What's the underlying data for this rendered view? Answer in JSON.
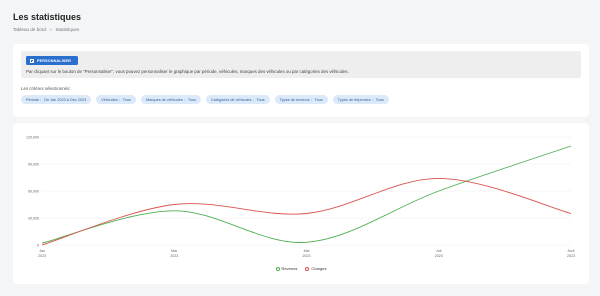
{
  "header": {
    "title": "Les statistiques",
    "breadcrumb": [
      "Tableau de bord",
      "Statistiques"
    ],
    "breadcrumb_sep": "›"
  },
  "filters": {
    "button_label": "PERSONNALISER",
    "info_text": "Par cliquant sur le bouton de \"Personnaliser\", vous pouvez personnaliser le graphique par période, véhicules, marques des véhicules ou par catégories des véhicules.",
    "criteria_label": "Les critères sélectionnés:",
    "chips": [
      {
        "key": "Période :",
        "value": "De Jan 2023 à Dec 2023"
      },
      {
        "key": "Véhicules :",
        "value": "Tous"
      },
      {
        "key": "Marques de véhicules :",
        "value": "Tous"
      },
      {
        "key": "Catégories de véhicules :",
        "value": "Tous"
      },
      {
        "key": "Types de revenus :",
        "value": "Tous"
      },
      {
        "key": "Types de dépenses :",
        "value": "Tous"
      }
    ]
  },
  "colors": {
    "revenus": "#4caf50",
    "charges": "#d9534f",
    "accent": "#2b6fce"
  },
  "chart_data": {
    "type": "line",
    "categories": [
      "Jan\n2023",
      "Mar\n2023",
      "Mai\n2023",
      "Juil\n2023",
      "Avril\n2023"
    ],
    "ylim": [
      0,
      120000
    ],
    "yticks": [
      "0",
      "30,000",
      "60,000",
      "90,000",
      "120,000"
    ],
    "series": [
      {
        "name": "Revenus",
        "values": [
          2000,
          38000,
          3000,
          60000,
          110000
        ]
      },
      {
        "name": "Charges",
        "values": [
          0,
          45000,
          35000,
          74000,
          35000
        ]
      }
    ]
  }
}
